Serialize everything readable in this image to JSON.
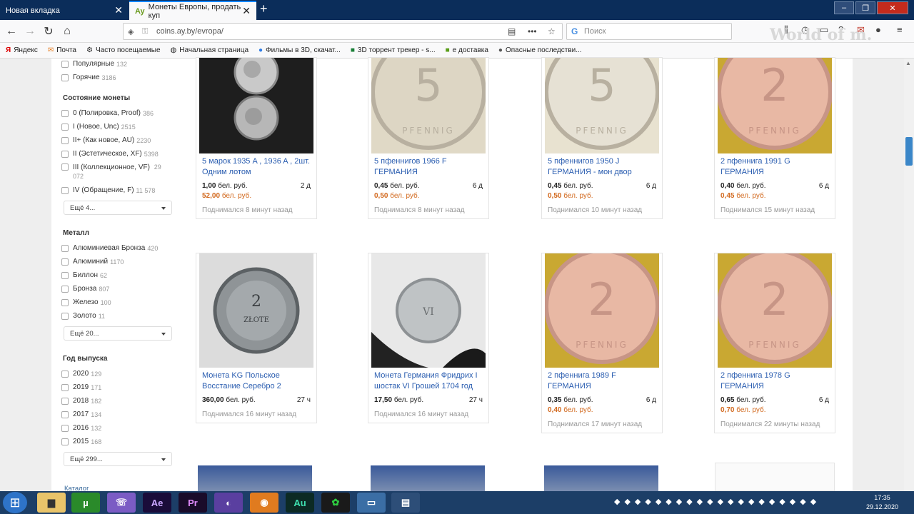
{
  "browser": {
    "tabs": [
      {
        "label": "Новая вкладка"
      },
      {
        "label": "Монеты Европы, продать куп"
      }
    ],
    "url": "coins.ay.by/evropa/",
    "search_placeholder": "Поиск",
    "watermark": "World of m.",
    "bookmarks": [
      "Яндекс",
      "Почта",
      "Часто посещаемые",
      "Начальная страница",
      "Фильмы в 3D, скачат...",
      "3D торрент трекер - s...",
      "е доставка",
      "Опасные последстви..."
    ]
  },
  "sidebar": {
    "top_filters": [
      {
        "label": "Популярные",
        "count": "132"
      },
      {
        "label": "Горячие",
        "count": "3186"
      }
    ],
    "condition": {
      "title": "Состояние монеты",
      "items": [
        {
          "label": "0 (Полировка, Proof)",
          "count": "386"
        },
        {
          "label": "I (Новое, Unc)",
          "count": "2515"
        },
        {
          "label": "II+ (Как новое, AU)",
          "count": "2230"
        },
        {
          "label": "II (Эстетическое, XF)",
          "count": "5398"
        },
        {
          "label": "III (Коллекционное, VF)",
          "count": "29 072"
        },
        {
          "label": "IV (Обращение, F)",
          "count": "11 578"
        }
      ],
      "more": "Ещё 4..."
    },
    "metal": {
      "title": "Металл",
      "items": [
        {
          "label": "Алюминиевая Бронза",
          "count": "420"
        },
        {
          "label": "Алюминий",
          "count": "1170"
        },
        {
          "label": "Биллон",
          "count": "62"
        },
        {
          "label": "Бронза",
          "count": "807"
        },
        {
          "label": "Железо",
          "count": "100"
        },
        {
          "label": "Золото",
          "count": "11"
        }
      ],
      "more": "Ещё 20..."
    },
    "year": {
      "title": "Год выпуска",
      "items": [
        {
          "label": "2020",
          "count": "129"
        },
        {
          "label": "2019",
          "count": "171"
        },
        {
          "label": "2018",
          "count": "182"
        },
        {
          "label": "2017",
          "count": "134"
        },
        {
          "label": "2016",
          "count": "132"
        },
        {
          "label": "2015",
          "count": "168"
        }
      ],
      "more": "Ещё 299..."
    },
    "catalog_link": "Каталог"
  },
  "listings": [
    {
      "title": "5 марок 1935 A , 1936 A , 2шт. Одним лотом",
      "price": "1,00",
      "currency": "бел. руб.",
      "price2": "52,00",
      "age": "2 д",
      "updated": "Поднимался 8 минут назад",
      "img": "silver-pair"
    },
    {
      "title": "5 пфеннигов 1966 F ГЕРМАНИЯ",
      "price": "0,45",
      "currency": "бел. руб.",
      "price2": "0,50",
      "age": "6 д",
      "updated": "Поднимался 8 минут назад",
      "img": "brass-5"
    },
    {
      "title": "5 пфеннигов 1950 J ГЕРМАНИЯ - мон двор",
      "price": "0,45",
      "currency": "бел. руб.",
      "price2": "0,50",
      "age": "6 д",
      "updated": "Поднимался 10 минут назад",
      "img": "brass-5-light"
    },
    {
      "title": "2 пфеннига 1991 G ГЕРМАНИЯ",
      "price": "0,40",
      "currency": "бел. руб.",
      "price2": "0,45",
      "age": "6 д",
      "updated": "Поднимался 15 минут назад",
      "img": "copper-2"
    },
    {
      "title": "Монета KG Польское Восстание Серебро 2",
      "price": "360,00",
      "currency": "бел. руб.",
      "price2": "",
      "age": "27 ч",
      "updated": "Поднимался 16 минут назад",
      "img": "silver-old"
    },
    {
      "title": "Монета Германия Фридрих I шостак VI Грошей 1704 год",
      "price": "17,50",
      "currency": "бел. руб.",
      "price2": "",
      "age": "27 ч",
      "updated": "Поднимался 16 минут назад",
      "img": "silver-hand"
    },
    {
      "title": "2 пфеннига 1989 F ГЕРМАНИЯ",
      "price": "0,35",
      "currency": "бел. руб.",
      "price2": "0,40",
      "age": "6 д",
      "updated": "Поднимался 17 минут назад",
      "img": "copper-2"
    },
    {
      "title": "2 пфеннига 1978 G ГЕРМАНИЯ",
      "price": "0,65",
      "currency": "бел. руб.",
      "price2": "0,70",
      "age": "6 д",
      "updated": "Поднимался 22 минуты назад",
      "img": "copper-2"
    }
  ],
  "taskbar": {
    "apps": [
      "Ae",
      "Pr",
      "Au"
    ],
    "time": "17:35",
    "date": "29.12.2020"
  }
}
